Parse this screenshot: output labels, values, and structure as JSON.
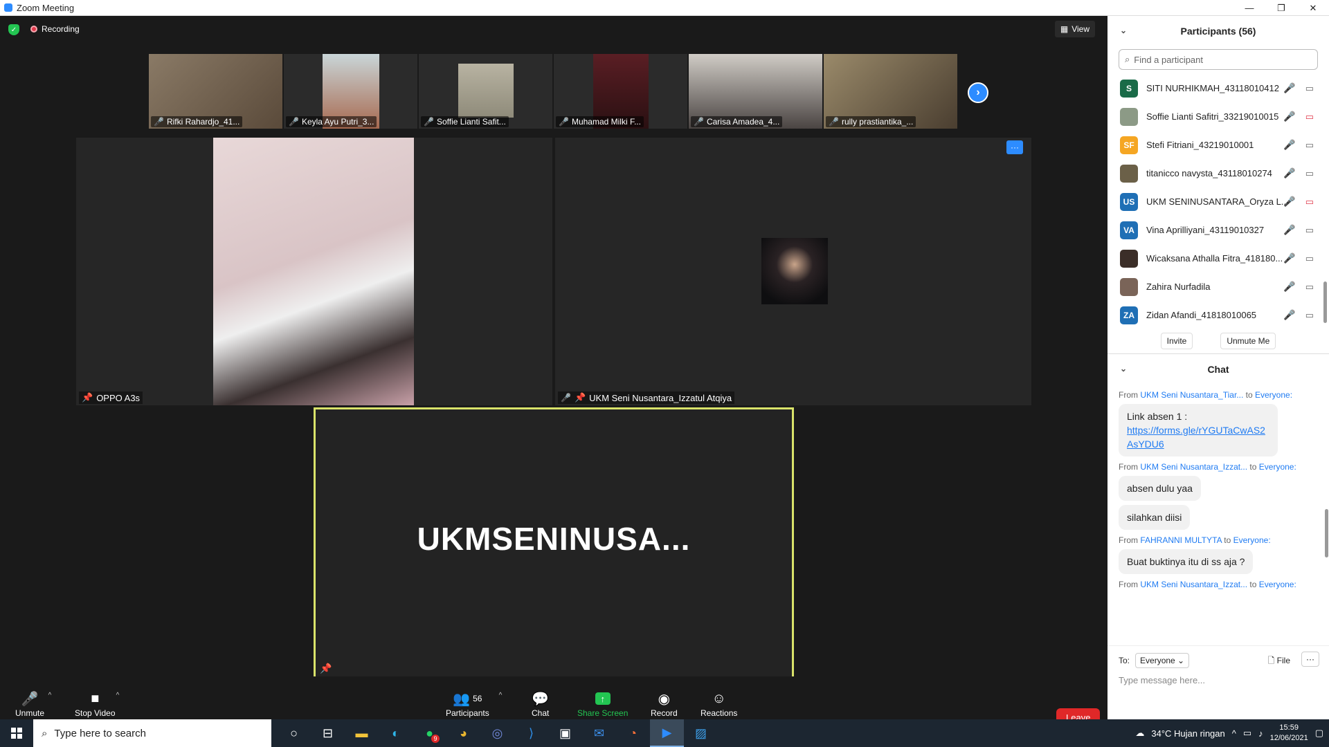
{
  "window": {
    "title": "Zoom Meeting"
  },
  "topbar": {
    "recording": "Recording",
    "view": "View"
  },
  "thumbnails": [
    {
      "name": "Rifki Rahardjo_41...",
      "color": "#6b5a4a"
    },
    {
      "name": "Keyla Ayu Putri_3...",
      "color": "#9c7c68"
    },
    {
      "name": "Soffie Lianti Safit...",
      "color": "#a8a392"
    },
    {
      "name": "Muhamad Milki F...",
      "color": "#4a1e22"
    },
    {
      "name": "Carisa Amadea_4...",
      "color": "#3a3634"
    },
    {
      "name": "rully prastiantika_...",
      "color": "#5d5040"
    }
  ],
  "tiles": {
    "left_label": "OPPO A3s",
    "right_label": "UKM Seni Nusantara_Izzatul Atqiya",
    "more": "···"
  },
  "speaker": {
    "name": "UKMSENINUSA..."
  },
  "toolbar": {
    "unmute": "Unmute",
    "stop_video": "Stop Video",
    "participants": "Participants",
    "participants_count": "56",
    "chat": "Chat",
    "share_screen": "Share Screen",
    "record": "Record",
    "reactions": "Reactions",
    "leave": "Leave"
  },
  "participants_panel": {
    "title": "Participants (56)",
    "search_placeholder": "Find a participant",
    "items": [
      {
        "initials": "S",
        "name": "SITI NURHIKMAH_43118010412",
        "color": "#1a6b48",
        "video_off": false
      },
      {
        "initials": "",
        "name": "Soffie Lianti Safitri_33219010015",
        "color": "#8c9a86",
        "video_off": true
      },
      {
        "initials": "SF",
        "name": "Stefi Fitriani_43219010001",
        "color": "#f5a623",
        "video_off": false
      },
      {
        "initials": "",
        "name": "titanicco navysta_43118010274",
        "color": "#6b6048",
        "video_off": false
      },
      {
        "initials": "US",
        "name": "UKM SENINUSANTARA_Oryza L...",
        "color": "#1f6fb5",
        "video_off": true
      },
      {
        "initials": "VA",
        "name": "Vina Aprilliyani_43119010327",
        "color": "#1f6fb5",
        "video_off": false
      },
      {
        "initials": "",
        "name": "Wicaksana Athalla Fitra_418180...",
        "color": "#3b2e28",
        "video_off": false
      },
      {
        "initials": "",
        "name": "Zahira Nurfadila",
        "color": "#7a6458",
        "video_off": false
      },
      {
        "initials": "ZA",
        "name": "Zidan Afandi_41818010065",
        "color": "#1f6fb5",
        "video_off": false
      }
    ],
    "invite": "Invite",
    "unmute_me": "Unmute Me"
  },
  "chat_panel": {
    "title": "Chat",
    "messages": [
      {
        "from_label": "From",
        "sender": "UKM Seni Nusantara_Tiar...",
        "to_label": "to",
        "to": "Everyone:",
        "bubbles": [
          "Link absen 1 :"
        ],
        "link": "https://forms.gle/rYGUTaCwAS2AsYDU6"
      },
      {
        "from_label": "From",
        "sender": "UKM Seni Nusantara_Izzat...",
        "to_label": "to",
        "to": "Everyone:",
        "bubbles": [
          "absen dulu yaa",
          "silahkan diisi"
        ]
      },
      {
        "from_label": "From",
        "sender": "FAHRANNI MULTYTA",
        "to_label": "to",
        "to": "Everyone:",
        "bubbles": [
          "Buat buktinya itu di ss aja ?"
        ]
      },
      {
        "from_label": "From",
        "sender": "UKM Seni Nusantara_Izzat...",
        "to_label": "to",
        "to": "Everyone:",
        "bubbles": []
      }
    ],
    "to_label": "To:",
    "to_value": "Everyone",
    "file": "File",
    "more": "···",
    "input_placeholder": "Type message here..."
  },
  "taskbar": {
    "search_placeholder": "Type here to search",
    "weather": "34°C  Hujan ringan",
    "time": "15:59",
    "date": "12/06/2021",
    "whatsapp_badge": "9"
  }
}
